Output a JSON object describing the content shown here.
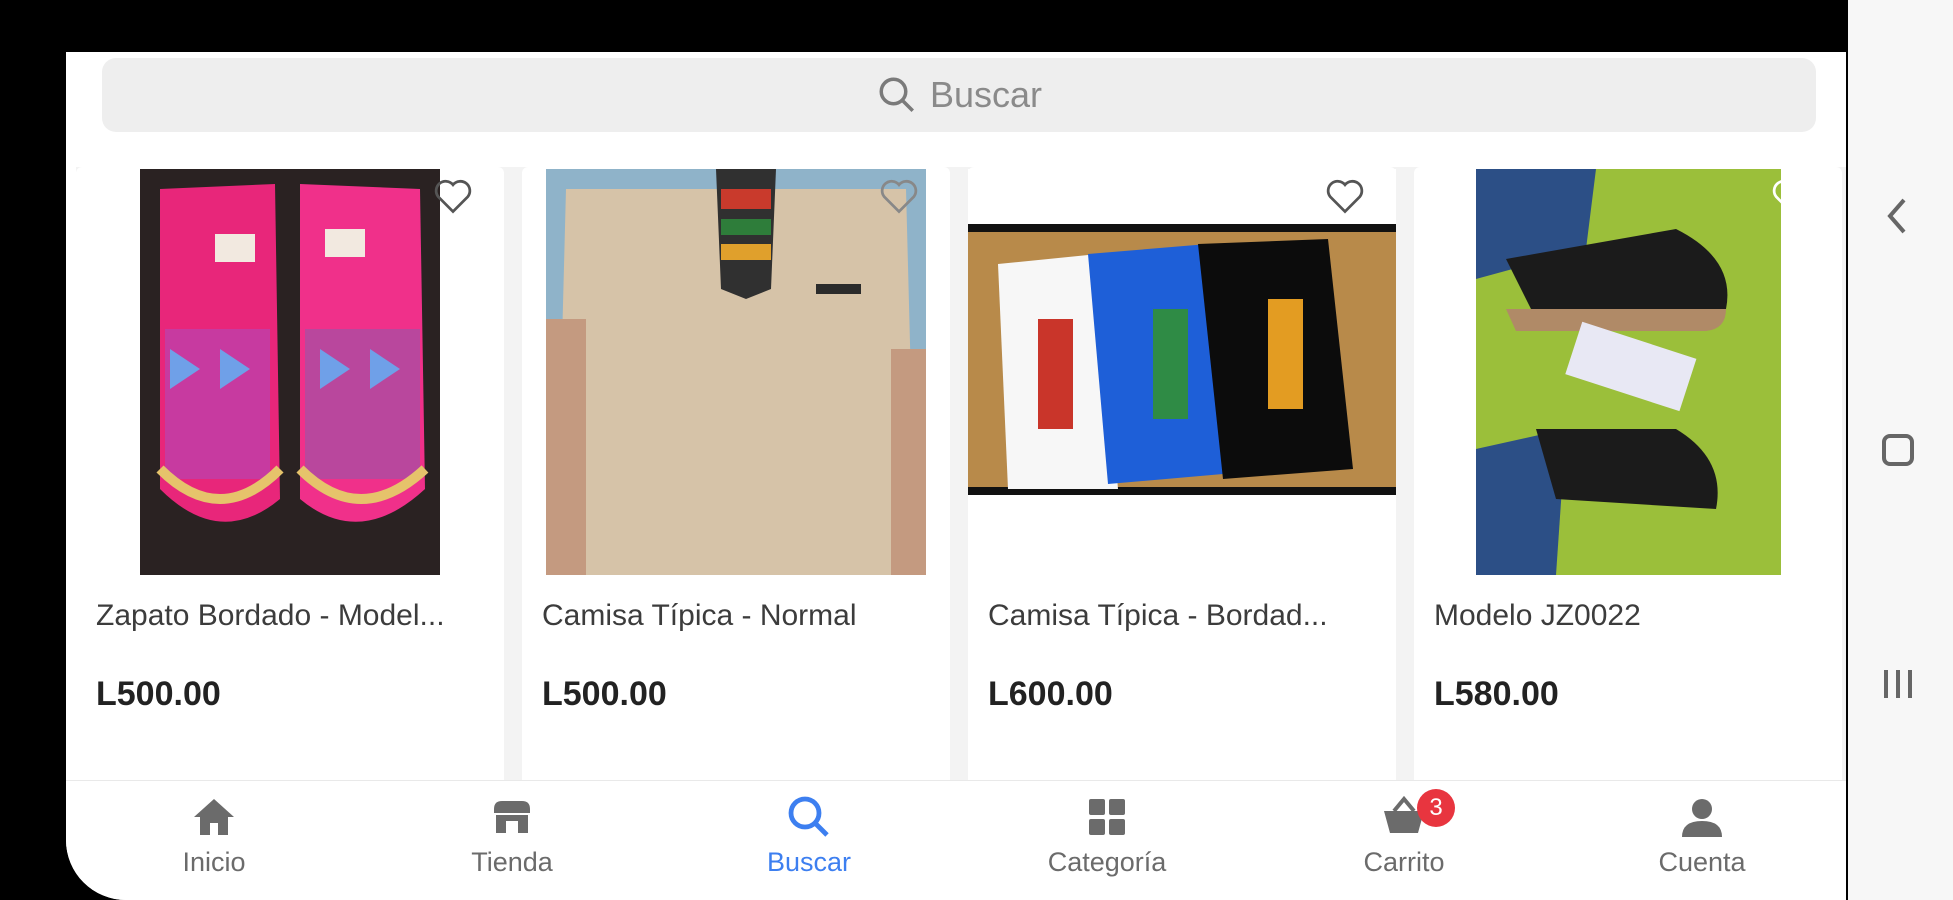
{
  "search": {
    "placeholder": "Buscar",
    "icon": "search-icon"
  },
  "products": [
    {
      "name": "Zapato Bordado - Model...",
      "price": "L500.00",
      "image": "embroidered-pink-shoes"
    },
    {
      "name": "Camisa Típica - Normal",
      "price": "L500.00",
      "image": "beige-typical-shirt"
    },
    {
      "name": "Camisa Típica - Bordad...",
      "price": "L600.00",
      "image": "three-embroidered-shirts"
    },
    {
      "name": "Modelo JZ0022",
      "price": "L580.00",
      "image": "black-espadrilles-on-grass"
    }
  ],
  "nav": {
    "items": [
      {
        "label": "Inicio",
        "icon": "home-icon"
      },
      {
        "label": "Tienda",
        "icon": "store-icon"
      },
      {
        "label": "Buscar",
        "icon": "search-icon",
        "active": true
      },
      {
        "label": "Categoría",
        "icon": "grid-icon"
      },
      {
        "label": "Carrito",
        "icon": "cart-icon",
        "badge": "3"
      },
      {
        "label": "Cuenta",
        "icon": "person-icon"
      }
    ]
  },
  "colors": {
    "active": "#3d7ff0",
    "badge": "#e8353f",
    "inactive": "#6b6b6b"
  }
}
